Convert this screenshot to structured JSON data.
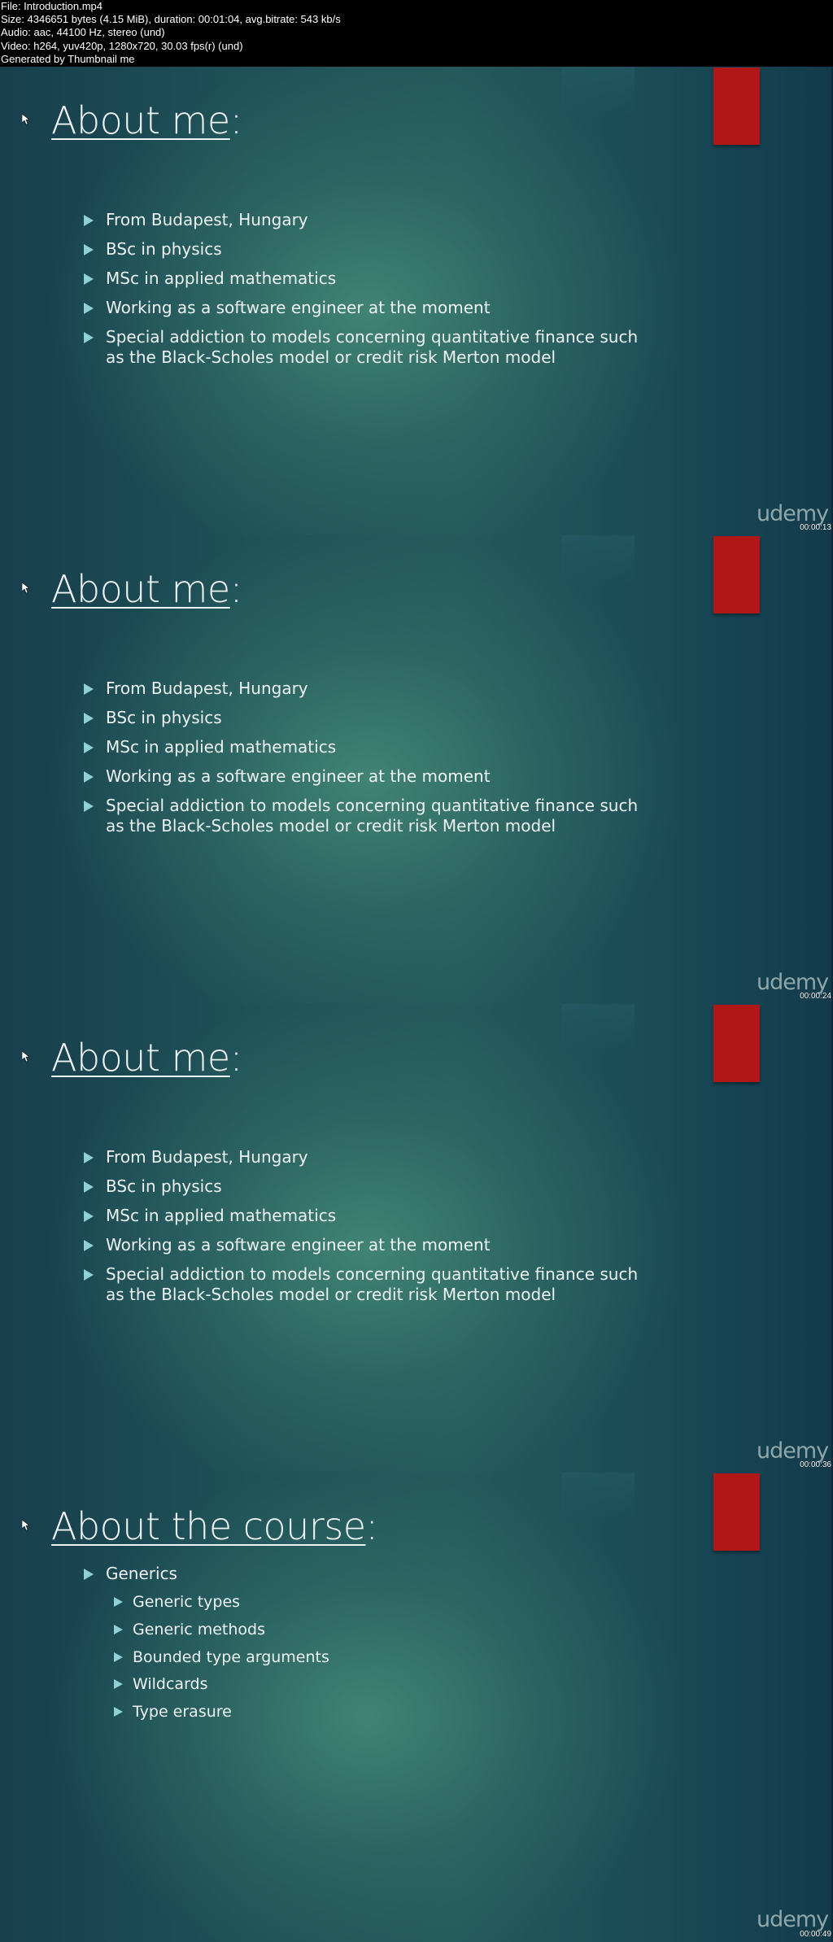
{
  "header": {
    "lines": [
      "File: Introduction.mp4",
      "Size: 4346651 bytes (4.15 MiB), duration: 00:01:04, avg.bitrate: 543 kb/s",
      "Audio: aac, 44100 Hz, stereo (und)",
      "Video: h264, yuv420p, 1280x720, 30.03 fps(r) (und)",
      "Generated by Thumbnail me"
    ]
  },
  "colors": {
    "accent_red": "#b01818",
    "bullet_arrow": "#8fd0d6",
    "text": "#eef3f2",
    "background_dark": "#173f4d",
    "background_light": "#3a7a6c"
  },
  "frames": [
    {
      "title": "About me",
      "title_suffix": ":",
      "bullets": [
        "From Budapest, Hungary",
        "BSc in physics",
        "MSc in applied mathematics",
        "Working as a software engineer at the moment",
        "Special addiction to models concerning quantitative finance such",
        "as the Black-Scholes model or credit risk Merton model"
      ],
      "logo": "udemy",
      "timestamp": "00:00:13"
    },
    {
      "title": "About me",
      "title_suffix": ":",
      "bullets": [
        "From Budapest, Hungary",
        "BSc in physics",
        "MSc in applied mathematics",
        "Working as a software engineer at the moment",
        "Special addiction to models concerning quantitative finance such",
        "as the Black-Scholes model or credit risk Merton model"
      ],
      "logo": "udemy",
      "timestamp": "00:00:24"
    },
    {
      "title": "About me",
      "title_suffix": ":",
      "bullets": [
        "From Budapest, Hungary",
        "BSc in physics",
        "MSc in applied mathematics",
        "Working as a software engineer at the moment",
        "Special addiction to models concerning quantitative finance such",
        "as the Black-Scholes model or credit risk Merton model"
      ],
      "logo": "udemy",
      "timestamp": "00:00:36"
    },
    {
      "title": "About the course",
      "title_suffix": ":",
      "top_bullet": "Generics",
      "sub_bullets": [
        "Generic types",
        "Generic methods",
        "Bounded type arguments",
        "Wildcards",
        "Type erasure"
      ],
      "logo": "udemy",
      "timestamp": "00:00:49"
    }
  ]
}
